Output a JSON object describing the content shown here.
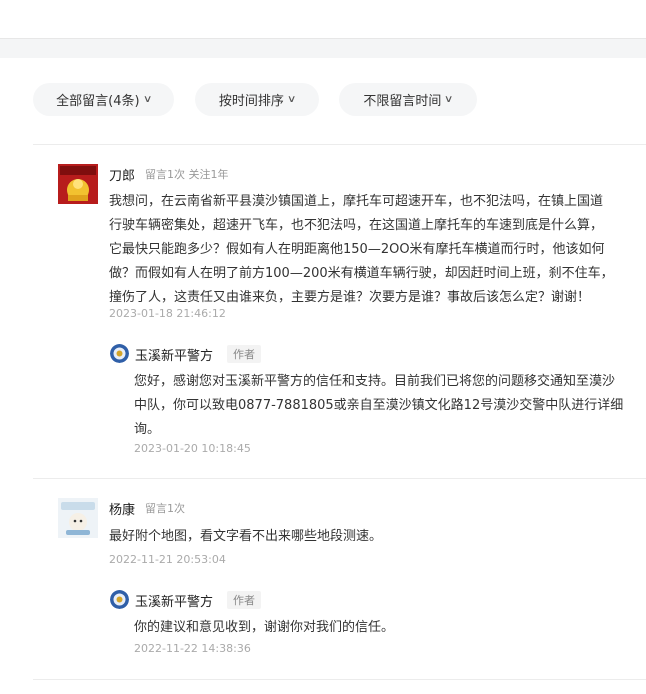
{
  "filters": {
    "all": "全部留言(4条)",
    "sort": "按时间排序",
    "time": "不限留言时间"
  },
  "comments": [
    {
      "user": "刀郎",
      "meta": "留言1次 关注1年",
      "text": "我想问，在云南省新平县漠沙镇国道上，摩托车可超速开车，也不犯法吗，在镇上国道\n行驶车辆密集处，超速开飞车，也不犯法吗，在这国道上摩托车的车速到底是什么算，\n它最快只能跑多少？假如有人在明距离他150—2OO米有摩托车横道而行时，他该如何\n做？而假如有人在明了前方100—200米有横道车辆行驶，却因赶时间上班，刹不住车，\n撞伤了人，这责任又由谁来负，主要方是谁？次要方是谁？事故后该怎么定？谢谢！",
      "time": "2023-01-18 21:46:12",
      "reply": {
        "user": "玉溪新平警方",
        "tag": "作者",
        "text": "您好，感谢您对玉溪新平警方的信任和支持。目前我们已将您的问题移交通知至漠沙\n中队，你可以致电0877-7881805或亲自至漠沙镇文化路12号漠沙交警中队进行详细\n询。",
        "time": "2023-01-20 10:18:45"
      }
    },
    {
      "user": "杨康",
      "meta": "留言1次",
      "text": "最好附个地图，看文字看不出来哪些地段测速。",
      "time": "2022-11-21 20:53:04",
      "reply": {
        "user": "玉溪新平警方",
        "tag": "作者",
        "text": "你的建议和意见收到，谢谢你对我们的信任。",
        "time": "2022-11-22 14:38:36"
      }
    }
  ]
}
